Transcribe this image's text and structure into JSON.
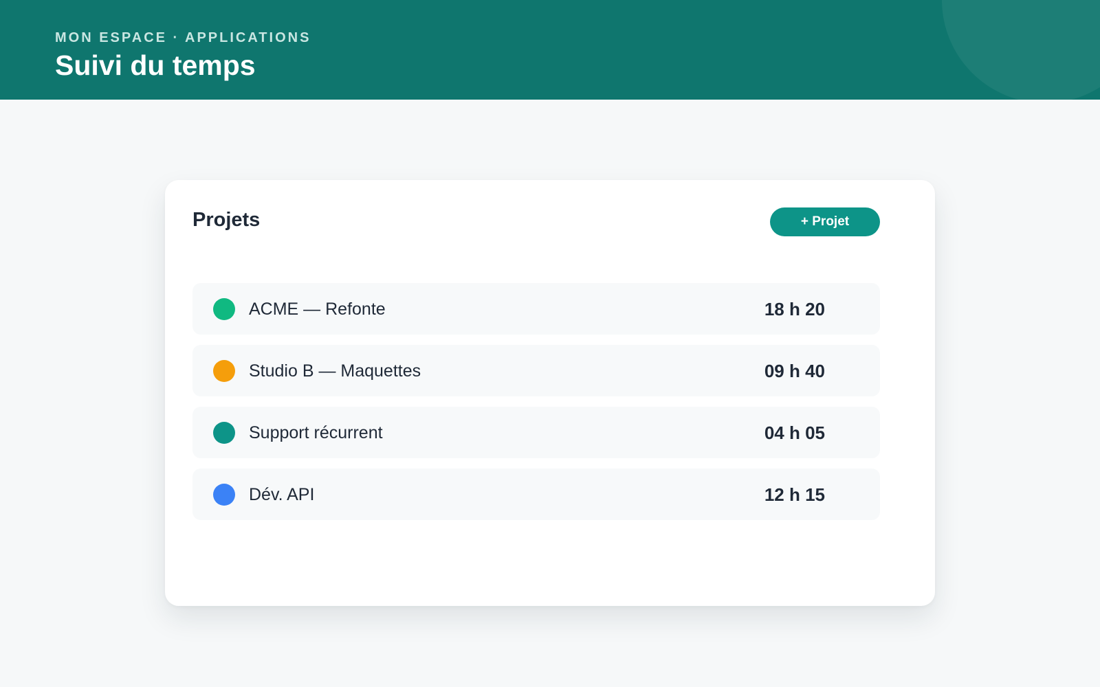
{
  "header": {
    "breadcrumb": "MON ESPACE · APPLICATIONS",
    "title": "Suivi du temps",
    "background_color": "#0f766e"
  },
  "card": {
    "title": "Projets",
    "add_button_label": "+ Projet",
    "accent_color": "#0d9488"
  },
  "projects": [
    {
      "name": "ACME — Refonte",
      "time": "18 h 20",
      "color": "#10b981"
    },
    {
      "name": "Studio B — Maquettes",
      "time": "09 h 40",
      "color": "#f59e0b"
    },
    {
      "name": "Support récurrent",
      "time": "04 h 05",
      "color": "#0d9488"
    },
    {
      "name": "Dév. API",
      "time": "12 h 15",
      "color": "#3b82f6"
    }
  ]
}
